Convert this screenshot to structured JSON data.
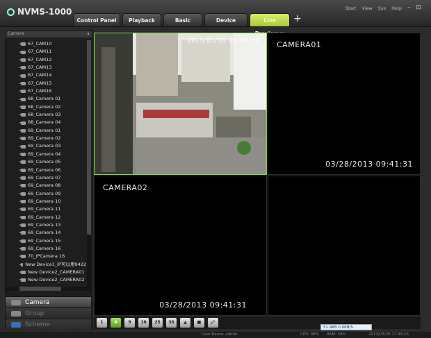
{
  "app": {
    "title": "NVMS-1000"
  },
  "tabs": [
    {
      "label": "Control Panel"
    },
    {
      "label": "Playback"
    },
    {
      "label": "Basic"
    },
    {
      "label": "Device"
    },
    {
      "label": "Live Preview",
      "close": "×"
    }
  ],
  "tab_add": "+",
  "top_menu": {
    "start": "Start",
    "view": "View",
    "sys": "Sys",
    "help": "Help",
    "minimize": "–",
    "restore": "⊡"
  },
  "sidebar": {
    "header": "Camera",
    "items": [
      "67_CAM10",
      "67_CAM11",
      "67_CAM12",
      "67_CAM13",
      "67_CAM14",
      "67_CAM15",
      "67_CAM16",
      "68_Camera 01",
      "68_Camera 02",
      "68_Camera 03",
      "68_Camera 04",
      "69_Camera 01",
      "69_Camera 02",
      "69_Camera 03",
      "69_Camera 04",
      "69_Camera 05",
      "69_Camera 06",
      "69_Camera 07",
      "69_Camera 08",
      "69_Camera 09",
      "69_Camera 10",
      "69_Camera 11",
      "69_Camera 12",
      "69_Camera 13",
      "69_Camera 14",
      "69_Camera 15",
      "69_Camera 16",
      "70_IPCamera 16",
      "New Device1_IP可以用9422",
      "New Device2_CAMERA01",
      "New Device2_CAMERA02"
    ],
    "nav": [
      "Camera",
      "Group",
      "Scheme"
    ]
  },
  "video": {
    "cell1": {
      "osd_timestamp": "2013/03/28 09:41:12"
    },
    "cell2": {
      "label": "CAMERA01",
      "timestamp": "03/28/2013 09:41:31"
    },
    "cell3": {
      "label": "CAMERA02",
      "timestamp": "03/28/2013 09:41:31"
    }
  },
  "toolbar": [
    "1",
    "4",
    "9",
    "16",
    "25",
    "36",
    "▲",
    "■",
    "⤢"
  ],
  "network": {
    "up": "51.9KB",
    "down": "0.0KB/S"
  },
  "status": {
    "user": "User Name: admin",
    "cpu": "CPU: 48%",
    "ram": "RAM: 58%",
    "datetime": "2013/03/28 17:49:16"
  }
}
